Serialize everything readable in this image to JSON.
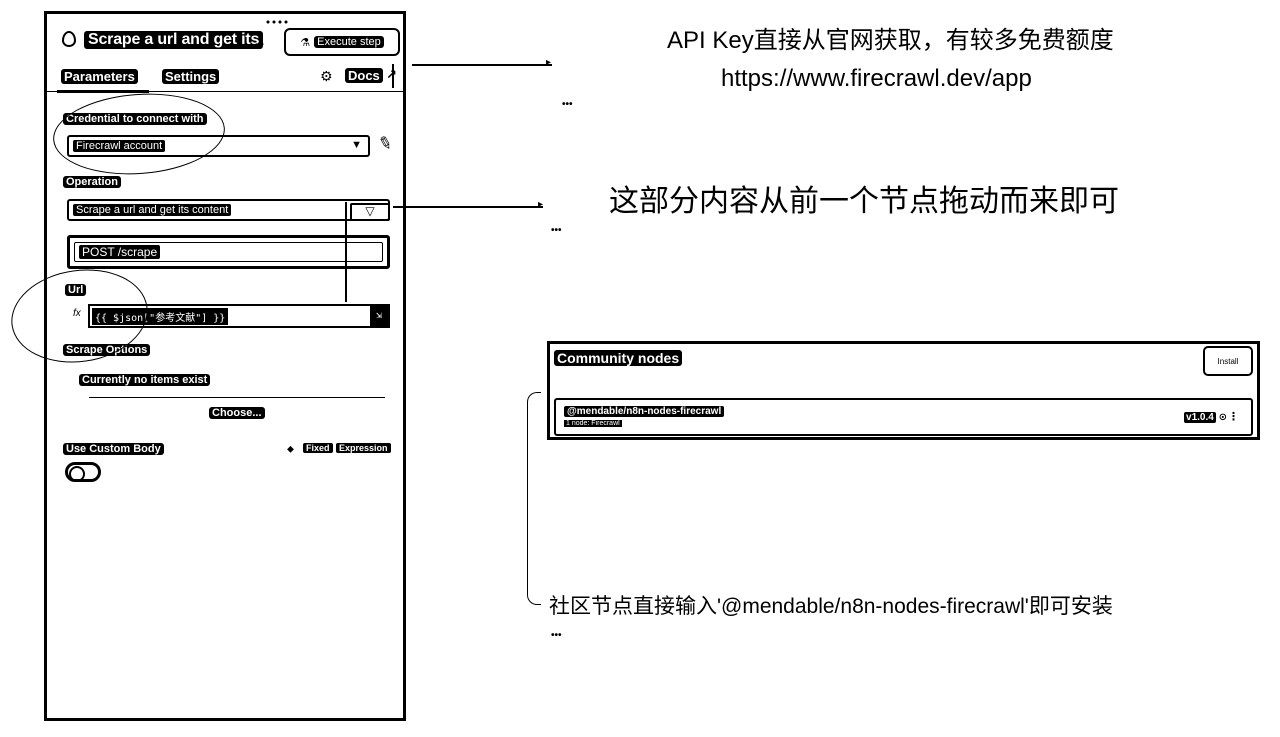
{
  "node": {
    "title": "Scrape a url and get its",
    "title_overflow": "...",
    "execute_label": "Execute step",
    "tabs": [
      "Parameters",
      "Settings"
    ],
    "docs_label": "Docs"
  },
  "credential": {
    "label": "Credential to connect with",
    "value": "Firecrawl account"
  },
  "operation": {
    "label": "Operation",
    "value": "Scrape a url and get its content",
    "endpoint": "POST /scrape"
  },
  "url_field": {
    "label": "Url",
    "value": "{{ $json[\"参考文献\"] }}",
    "fx_label": "fx"
  },
  "scrape_options": {
    "label": "Scrape Options",
    "empty_note": "Currently no items exist",
    "choose_label": "Choose..."
  },
  "custom_body": {
    "label": "Use Custom Body",
    "fixed_label": "Fixed",
    "expression_label": "Expression",
    "enabled": false
  },
  "annotations": {
    "api_key_line1": "API Key直接从官网获取，有较多免费额度",
    "api_key_line2": "https://www.firecrawl.dev/app",
    "drag_note": "这部分内容从前一个节点拖动而来即可",
    "install_note": "社区节点直接输入'@mendable/n8n-nodes-firecrawl'即可安装"
  },
  "community_nodes": {
    "title": "Community nodes",
    "install_label": "Install",
    "package": "@mendable/n8n-nodes-firecrawl",
    "sub": "1 node: Firecrawl",
    "version": "v1.0.4"
  }
}
